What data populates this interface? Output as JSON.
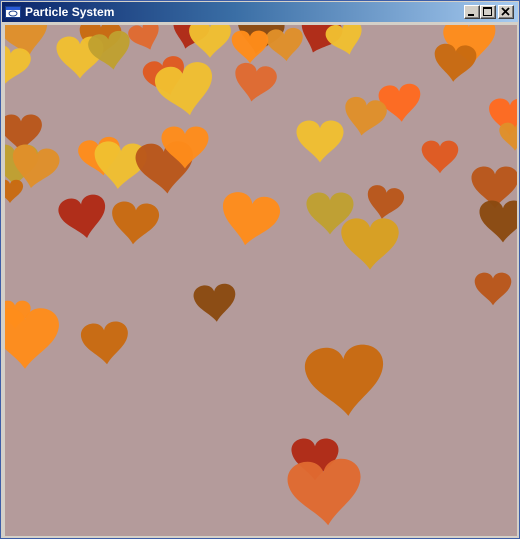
{
  "window": {
    "title": "Particle System",
    "icon": "app-window-icon",
    "controls": {
      "minimize": "minimize-icon",
      "maximize": "maximize-icon",
      "close": "close-icon"
    }
  },
  "scene": {
    "background_color": "#b49b9b",
    "particle_shape": "heart",
    "particle_colors": [
      "#ff8c1a",
      "#e8c33a",
      "#c96a10",
      "#b9561a",
      "#a84a12",
      "#d9a020",
      "#e05a20",
      "#ff6a1f",
      "#c0a030",
      "#8a4a10",
      "#b02a15",
      "#e06a30",
      "#f0c030",
      "#e0902a"
    ]
  }
}
